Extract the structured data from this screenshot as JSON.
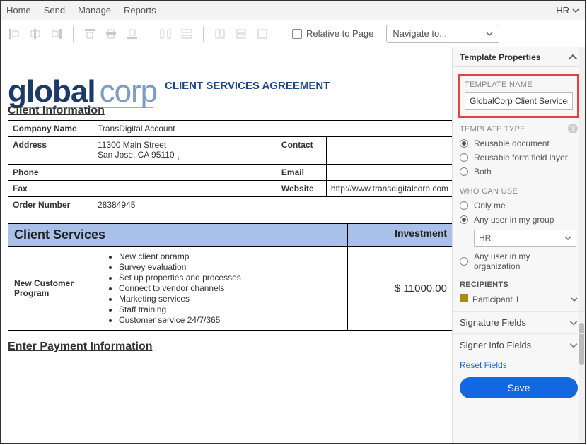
{
  "menubar": {
    "items": [
      "Home",
      "Send",
      "Manage",
      "Reports"
    ],
    "user_label": "HR"
  },
  "toolbar": {
    "relative_to_page": "Relative to Page",
    "navigate": "Navigate to..."
  },
  "document": {
    "logo_part1": "global",
    "logo_part2": "corp",
    "title": "CLIENT SERVICES AGREEMENT",
    "section_client_info": "Client Information",
    "fields": {
      "company_name_label": "Company Name",
      "company_name_value": "TransDigital Account",
      "address_label": "Address",
      "address_line1": "11300 Main Street",
      "address_line2": "San Jose, CA  95110",
      "contact_label": "Contact",
      "contact_value": "",
      "phone_label": "Phone",
      "phone_value": "",
      "email_label": "Email",
      "email_value": "",
      "fax_label": "Fax",
      "fax_value": "",
      "website_label": "Website",
      "website_value": "http://www.transdigitalcorp.com",
      "order_label": "Order Number",
      "order_value": "28384945"
    },
    "services_header": "Client Services",
    "investment_header": "Investment",
    "program_name": "New Customer Program",
    "program_items": [
      "New client onramp",
      "Survey evaluation",
      "Set up properties and processes",
      "Connect to vendor channels",
      "Marketing services",
      "Staff training",
      "Customer service 24/7/365"
    ],
    "program_price": "$ 11000.00",
    "section_payment": "Enter Payment Information"
  },
  "panel": {
    "header": "Template Properties",
    "template_name_label": "TEMPLATE NAME",
    "template_name_value": "GlobalCorp Client Services Agreement",
    "template_type_label": "TEMPLATE TYPE",
    "type_options": [
      "Reusable document",
      "Reusable form field layer",
      "Both"
    ],
    "type_selected": 0,
    "who_label": "WHO CAN USE",
    "who_options": [
      "Only me",
      "Any user in my group",
      "Any user in my organization"
    ],
    "who_selected": 1,
    "who_group_value": "HR",
    "recipients_label": "RECIPIENTS",
    "recipient_name": "Participant 1",
    "accordion_sig": "Signature Fields",
    "accordion_signer": "Signer Info Fields",
    "reset": "Reset Fields",
    "save": "Save"
  }
}
